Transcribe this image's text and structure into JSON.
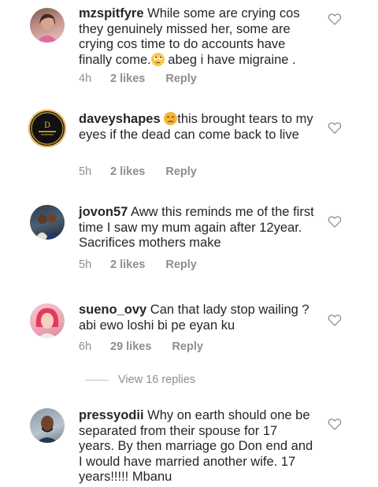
{
  "comments": [
    {
      "username": "mzspitfyre",
      "text_before": "While some are crying cos they genuinely missed her, some are crying cos time to do accounts have finally come.",
      "emoji": "rolling-eyes-emoji",
      "text_after": " abeg i have migraine .",
      "time": "4h",
      "likes": "2 likes",
      "reply": "Reply"
    },
    {
      "username": "daveyshapes",
      "text_before": "",
      "emoji": "crying-face-emoji",
      "text_after": "this brought tears to my eyes if the dead can come back to live",
      "time": "5h",
      "likes": "2 likes",
      "reply": "Reply"
    },
    {
      "username": "jovon57",
      "text_before": "Aww this reminds me of the first time I saw my mum again after 12year. Sacrifices mothers make",
      "time": "5h",
      "likes": "2 likes",
      "reply": "Reply"
    },
    {
      "username": "sueno_ovy",
      "text_before": "Can that lady stop wailing ? abi ewo loshi bi pe eyan ku",
      "time": "6h",
      "likes": "29 likes",
      "reply": "Reply"
    },
    {
      "username": "pressyodii",
      "text_before": "Why on earth should one be separated from their spouse for 17 years. By then marriage go Don end and I would have married another wife. 17 years!!!!! Mbanu"
    }
  ],
  "view_replies": "View 16 replies",
  "icons": {
    "like": "heart-outline-icon"
  },
  "colors": {
    "text": "#262626",
    "meta": "#8e8e8e"
  }
}
